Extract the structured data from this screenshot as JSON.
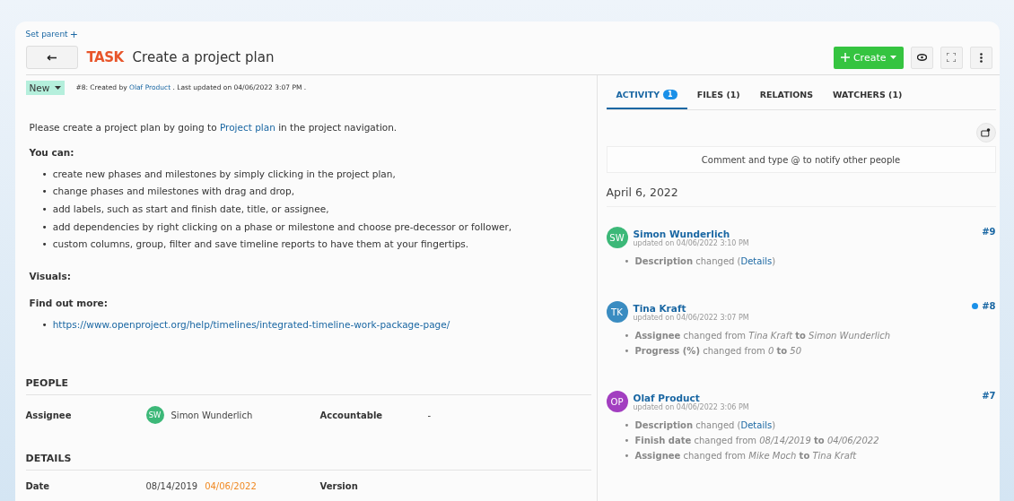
{
  "set_parent": {
    "label": "Set parent",
    "icon": "+"
  },
  "header": {
    "type": "TASK",
    "title": "Create a project plan"
  },
  "toolbar": {
    "create": "Create"
  },
  "status": {
    "label": "New",
    "meta_before": "#8: Created by ",
    "author": "Olaf Product",
    "meta_after": " . Last updated on 04/06/2022 3:07 PM ."
  },
  "description": {
    "intro_before": "Please create a project plan by going to ",
    "intro_link": "Project plan",
    "intro_after": " in the project navigation.",
    "you_can": "You can:",
    "marker": "•",
    "bullets": [
      "create new phases and milestones by simply clicking in the project plan,",
      "change phases and milestones with drag and drop,",
      "add labels, such as start and finish date, title, or assignee,",
      "add dependencies by right clicking on a phase or milestone and choose pre-decessor or follower,",
      "custom columns, group, filter and save timeline reports to have them at your fingertips."
    ],
    "visuals": "Visuals:",
    "find_out": "Find out more:",
    "links": [
      "https://www.openproject.org/help/timelines/integrated-timeline-work-package-page/"
    ]
  },
  "people": {
    "heading": "PEOPLE",
    "assignee_label": "Assignee",
    "assignee_initials": "SW",
    "assignee_name": "Simon Wunderlich",
    "accountable_label": "Accountable",
    "accountable_value": "-"
  },
  "details": {
    "heading": "DETAILS",
    "date_label": "Date",
    "start": "08/14/2019",
    "finish": "04/06/2022",
    "version_label": "Version"
  },
  "tabs": [
    {
      "label": "ACTIVITY",
      "badge": "1",
      "selected": true
    },
    {
      "label": "FILES (1)",
      "selected": false
    },
    {
      "label": "RELATIONS",
      "selected": false
    },
    {
      "label": "WATCHERS (1)",
      "selected": false
    }
  ],
  "comment": {
    "placeholder": "Comment and type @ to notify other people"
  },
  "activity_date": "April 6, 2022",
  "change_marker": "•",
  "activities": [
    {
      "initials": "SW",
      "color": "#3cb878",
      "name": "Simon Wunderlich",
      "updated": "updated on 04/06/2022 3:10 PM",
      "number": "#9",
      "unread": false,
      "changes": [
        {
          "text": "**Description** changed (",
          "link": "Details",
          "after": ")"
        }
      ]
    },
    {
      "initials": "TK",
      "color": "#3a8cc1",
      "name": "Tina Kraft",
      "updated": "updated on 04/06/2022 3:07 PM",
      "number": "#8",
      "unread": true,
      "changes": [
        {
          "text": "**Assignee** changed from *Tina Kraft* **to** *Simon Wunderlich*"
        },
        {
          "text": "**Progress (%)** changed from *0* **to** *50*"
        }
      ]
    },
    {
      "initials": "OP",
      "color": "#a23ec0",
      "name": "Olaf Product",
      "updated": "updated on 04/06/2022 3:06 PM",
      "number": "#7",
      "unread": false,
      "changes": [
        {
          "text": "**Description** changed (",
          "link": "Details",
          "after": ")"
        },
        {
          "text": "**Finish date** changed from *08/14/2019* **to** *04/06/2022*"
        },
        {
          "text": "**Assignee** changed from *Mike Moch* **to** *Tina Kraft*"
        }
      ]
    }
  ]
}
